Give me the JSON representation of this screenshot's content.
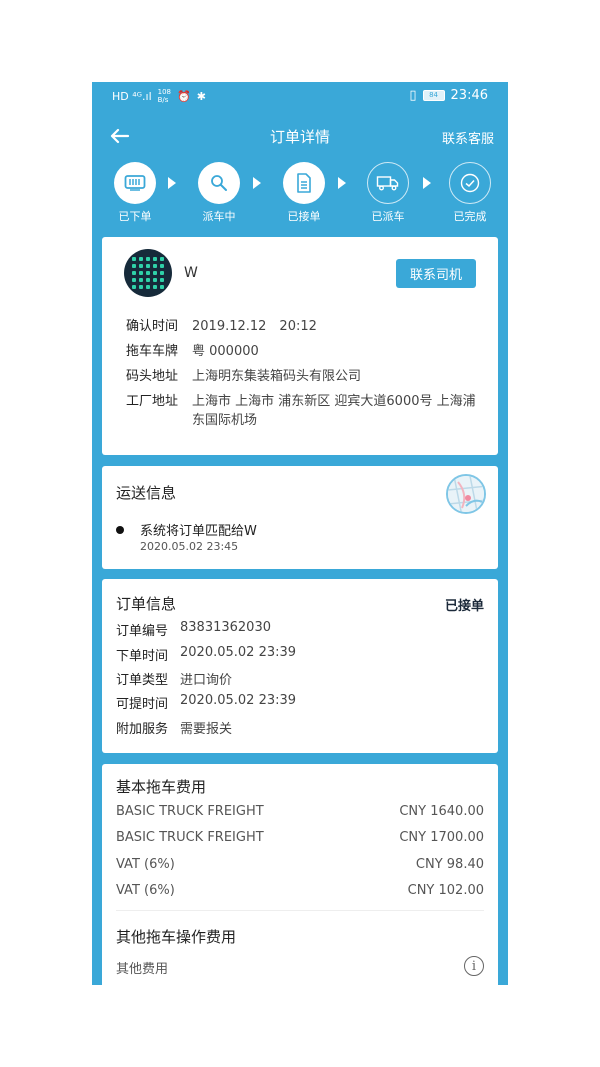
{
  "status_bar": {
    "network": "HD ⁴ᴳ.ıl",
    "speed_value": "108",
    "speed_unit": "B/s",
    "battery": "84",
    "time": "23:46"
  },
  "nav": {
    "title": "订单详情",
    "contact_service": "联系客服"
  },
  "steps": [
    {
      "label": "已下单",
      "icon": "order-placed-icon",
      "state": "active"
    },
    {
      "label": "派车中",
      "icon": "search-icon",
      "state": "active"
    },
    {
      "label": "已接单",
      "icon": "document-icon",
      "state": "active"
    },
    {
      "label": "已派车",
      "icon": "truck-icon",
      "state": "inactive"
    },
    {
      "label": "已完成",
      "icon": "check-circle-icon",
      "state": "inactive"
    }
  ],
  "driver": {
    "name": "W",
    "contact_button": "联系司机",
    "fields": [
      {
        "key": "确认时间",
        "value": "2019.12.12　20:12"
      },
      {
        "key": "拖车车牌",
        "value": "粤 000000"
      },
      {
        "key": "码头地址",
        "value": "上海明东集装箱码头有限公司"
      },
      {
        "key": "工厂地址",
        "value": "上海市 上海市 浦东新区 迎宾大道6000号 上海浦东国际机场"
      }
    ]
  },
  "shipping": {
    "title": "运送信息",
    "event_text": "系统将订单匹配给W",
    "event_time": "2020.05.02 23:45"
  },
  "order": {
    "title": "订单信息",
    "status": "已接单",
    "fields": [
      {
        "key": "订单编号",
        "value": "83831362030"
      },
      {
        "key": "下单时间",
        "value": "2020.05.02 23:39"
      },
      {
        "key": "订单类型",
        "value": "进口询价"
      },
      {
        "key": "可提时间",
        "value": "2020.05.02 23:39"
      },
      {
        "key": "附加服务",
        "value": "需要报关"
      }
    ]
  },
  "fees": {
    "title": "基本拖车费用",
    "items": [
      {
        "name": "BASIC TRUCK FREIGHT",
        "amount": "CNY 1640.00"
      },
      {
        "name": "BASIC TRUCK FREIGHT",
        "amount": "CNY 1700.00"
      },
      {
        "name": "VAT (6%)",
        "amount": "CNY 98.40"
      },
      {
        "name": "VAT (6%)",
        "amount": "CNY 102.00"
      }
    ],
    "other_title": "其他拖车操作费用",
    "other_label": "其他费用"
  },
  "colors": {
    "primary": "#3aa8d8",
    "card": "#ffffff",
    "avatar_bg": "#162a3a",
    "avatar_dots": "#2fd1a8"
  }
}
